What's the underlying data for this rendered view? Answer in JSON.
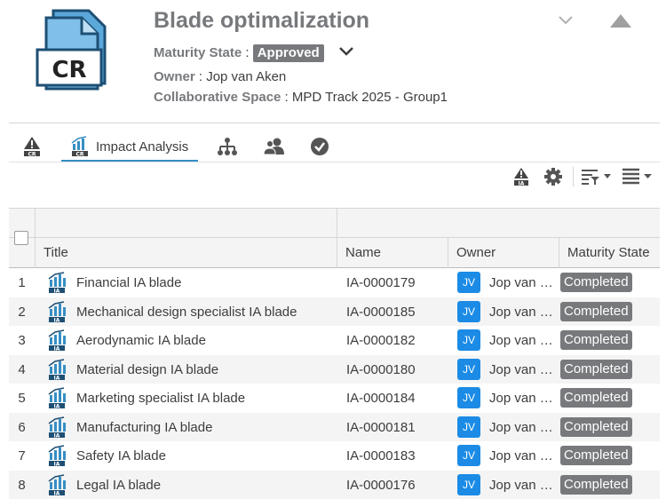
{
  "header": {
    "icon_text": "CR",
    "title": "Blade optimalization",
    "maturity_label": "Maturity State",
    "maturity_value": "Approved",
    "owner_label": "Owner",
    "owner_value": "Jop van Aken",
    "space_label": "Collaborative Space",
    "space_value": "MPD Track 2025 - Group1",
    "sep": " : "
  },
  "tabs": [
    {
      "icon": "cr-warning-icon",
      "label": ""
    },
    {
      "icon": "impact-analysis-icon",
      "label": "Impact Analysis",
      "active": true
    },
    {
      "icon": "hierarchy-icon",
      "label": ""
    },
    {
      "icon": "members-icon",
      "label": ""
    },
    {
      "icon": "checkmark-icon",
      "label": ""
    }
  ],
  "toolbar": [
    "ia-new-icon",
    "settings-icon",
    "filter-icon",
    "list-view-icon"
  ],
  "table": {
    "columns": [
      "Title",
      "Name",
      "Owner",
      "Maturity State"
    ],
    "rows": [
      {
        "num": "1",
        "title": "Financial IA blade",
        "name": "IA-0000179",
        "initials": "JV",
        "owner": "Jop van …",
        "state": "Completed"
      },
      {
        "num": "2",
        "title": "Mechanical design specialist IA blade",
        "name": "IA-0000185",
        "initials": "JV",
        "owner": "Jop van …",
        "state": "Completed"
      },
      {
        "num": "3",
        "title": "Aerodynamic IA blade",
        "name": "IA-0000182",
        "initials": "JV",
        "owner": "Jop van …",
        "state": "Completed"
      },
      {
        "num": "4",
        "title": "Material design IA blade",
        "name": "IA-0000180",
        "initials": "JV",
        "owner": "Jop van …",
        "state": "Completed"
      },
      {
        "num": "5",
        "title": "Marketing specialist IA blade",
        "name": "IA-0000184",
        "initials": "JV",
        "owner": "Jop van …",
        "state": "Completed"
      },
      {
        "num": "6",
        "title": "Manufacturing IA blade",
        "name": "IA-0000181",
        "initials": "JV",
        "owner": "Jop van …",
        "state": "Completed"
      },
      {
        "num": "7",
        "title": "Safety IA blade",
        "name": "IA-0000183",
        "initials": "JV",
        "owner": "Jop van …",
        "state": "Completed"
      },
      {
        "num": "8",
        "title": "Legal IA blade",
        "name": "IA-0000176",
        "initials": "JV",
        "owner": "Jop van …",
        "state": "Completed"
      }
    ]
  },
  "colors": {
    "accent": "#368ec4",
    "badge": "#77797c",
    "avatar": "#1b8be6"
  }
}
